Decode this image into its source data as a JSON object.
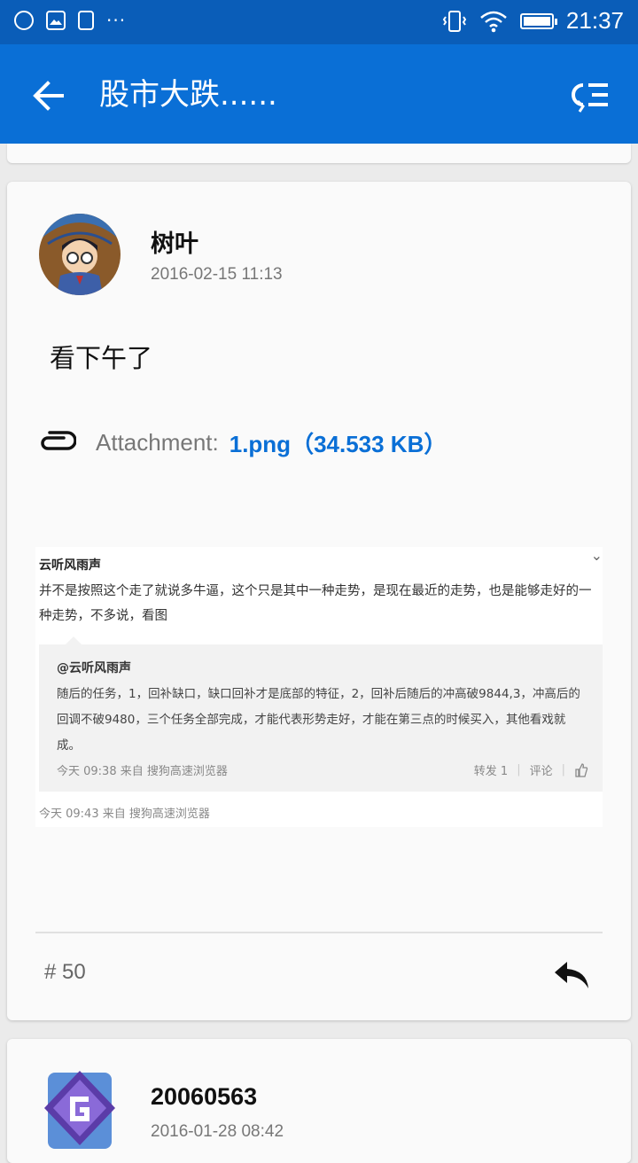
{
  "status_bar": {
    "time": "21:37",
    "left_icons": [
      "disc-icon",
      "image-icon",
      "usb-icon"
    ],
    "dots": "···",
    "right_icons": [
      "vibrate-icon",
      "wifi-icon",
      "battery-icon"
    ]
  },
  "app_bar": {
    "title": "股市大跌......",
    "back_icon": "arrow-left-icon",
    "menu_icon": "list-menu-icon"
  },
  "post": {
    "author": "树叶",
    "date": "2016-02-15 11:13",
    "text": "看下午了",
    "attachment": {
      "label": "Attachment:",
      "file": "1.png（34.533 KB）"
    },
    "embedded_image": {
      "name": "云听风雨声",
      "text": "并不是按照这个走了就说多牛逼，这个只是其中一种走势，是现在最近的走势，也是能够走好的一种走势，不多说，看图",
      "quote": {
        "name": "@云听风雨声",
        "text": "随后的任务，1，回补缺口，缺口回补才是底部的特征，2，回补后随后的冲高破9844,3，冲高后的回调不破9480，三个任务全部完成，才能代表形势走好，才能在第三点的时候买入，其他看戏就成。",
        "meta": "今天 09:38 来自 搜狗高速浏览器",
        "repost": "转发 1",
        "comment": "评论"
      },
      "meta": "今天 09:43 来自 搜狗高速浏览器"
    },
    "floor": "# 50"
  },
  "next_post": {
    "author": "20060563",
    "date": "2016-01-28 08:42"
  },
  "colors": {
    "status_bar": "#0a5db8",
    "app_bar": "#0a6fd6",
    "link": "#0a6fd6"
  }
}
